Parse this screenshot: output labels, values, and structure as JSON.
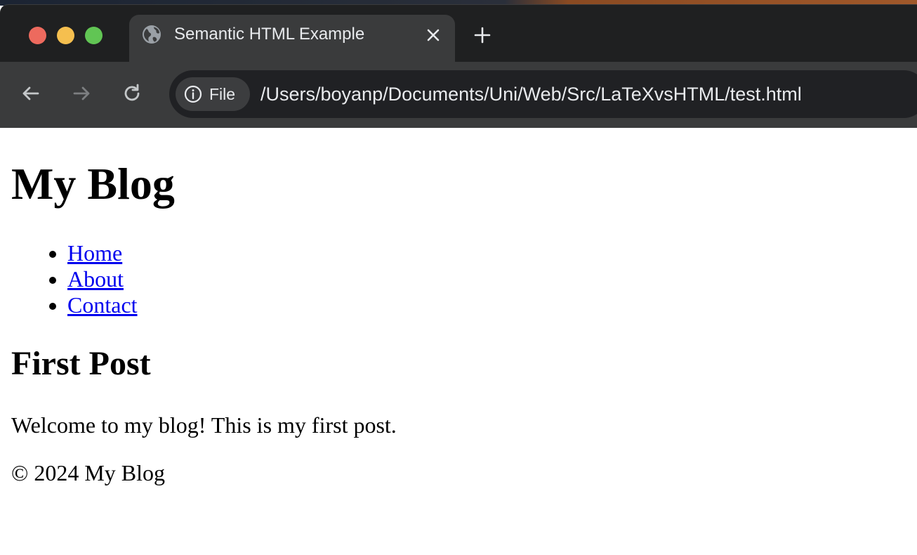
{
  "browser": {
    "tab": {
      "title": "Semantic HTML Example",
      "favicon": "globe-icon",
      "close": "close-icon"
    },
    "new_tab": "plus-icon",
    "toolbar": {
      "back": "arrow-left-icon",
      "forward": "arrow-right-icon",
      "reload": "reload-icon",
      "site_info_chip": {
        "icon": "info-icon",
        "label": "File"
      },
      "url": "/Users/boyanp/Documents/Uni/Web/Src/LaTeXvsHTML/test.html"
    },
    "colors": {
      "tabstrip_bg": "#1f2021",
      "active_tab_bg": "#3a3b3c",
      "omnibox_bg": "#202124",
      "text": "#e8eaed",
      "traffic_close": "#ed6a5e",
      "traffic_minimize": "#f5bf4f",
      "traffic_maximize": "#61c554"
    }
  },
  "page": {
    "header": {
      "title": "My Blog"
    },
    "nav": {
      "links": [
        {
          "label": "Home"
        },
        {
          "label": "About"
        },
        {
          "label": "Contact"
        }
      ]
    },
    "article": {
      "title": "First Post",
      "body": "Welcome to my blog! This is my first post."
    },
    "footer": {
      "text": "© 2024 My Blog"
    },
    "colors": {
      "link": "#0000ee",
      "text": "#000000",
      "background": "#ffffff"
    }
  }
}
